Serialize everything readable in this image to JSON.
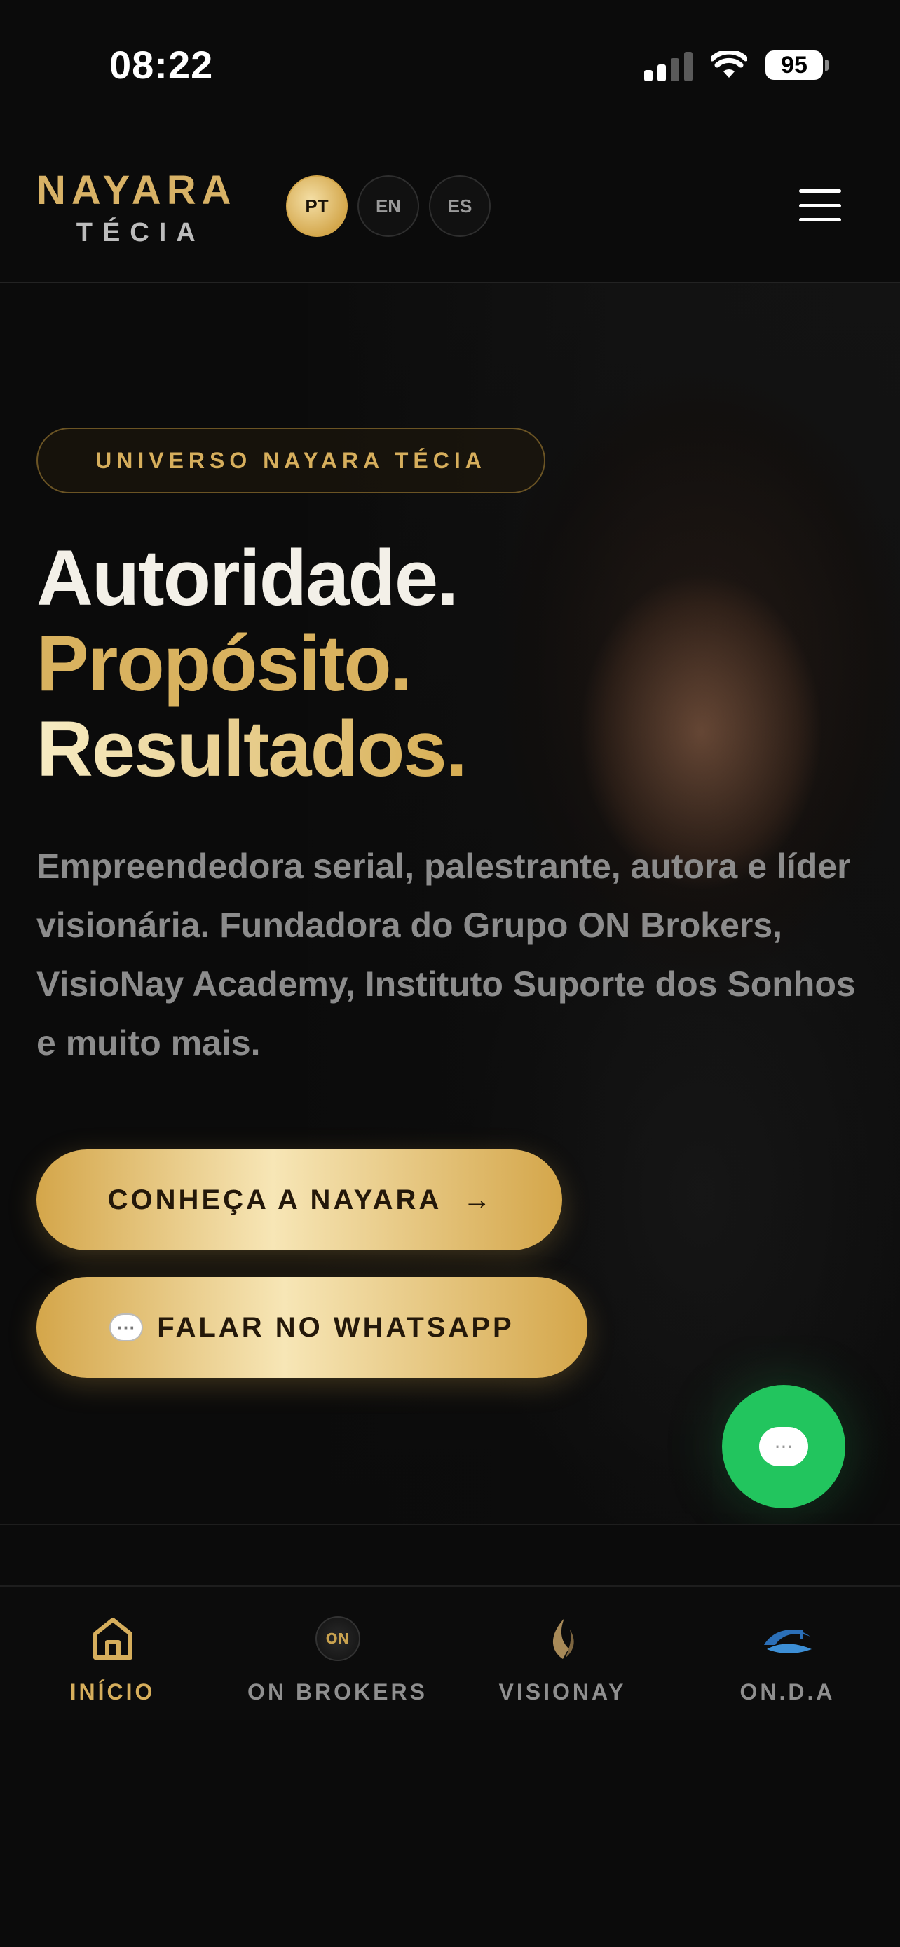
{
  "status_bar": {
    "time": "08:22",
    "battery": "95"
  },
  "header": {
    "logo_top": "NAYARA",
    "logo_bottom": "TÉCIA",
    "languages": [
      {
        "label": "PT",
        "active": true
      },
      {
        "label": "EN",
        "active": false
      },
      {
        "label": "ES",
        "active": false
      }
    ]
  },
  "hero": {
    "badge": "UNIVERSO NAYARA TÉCIA",
    "headline": [
      "Autoridade.",
      "Propósito.",
      "Resultados."
    ],
    "description": "Empreendedora serial, palestrante, autora e líder visionária. Fundadora do Grupo ON Brokers, VisioNay Academy, Instituto Suporte dos Sonhos e muito mais.",
    "primary_button": "CONHEÇA A NAYARA",
    "secondary_button": "FALAR NO WHATSAPP"
  },
  "bottom_nav": [
    {
      "label": "INÍCIO",
      "icon": "home-icon",
      "active": true
    },
    {
      "label": "ON BROKERS",
      "icon": "on-brokers-logo-icon",
      "active": false
    },
    {
      "label": "VISIONAY",
      "icon": "visionay-logo-icon",
      "active": false
    },
    {
      "label": "ON.D.A",
      "icon": "onda-logo-icon",
      "active": false
    }
  ],
  "colors": {
    "gold": "#d6ae5c",
    "whatsapp_green": "#22c55e",
    "background": "#0b0b0b"
  }
}
